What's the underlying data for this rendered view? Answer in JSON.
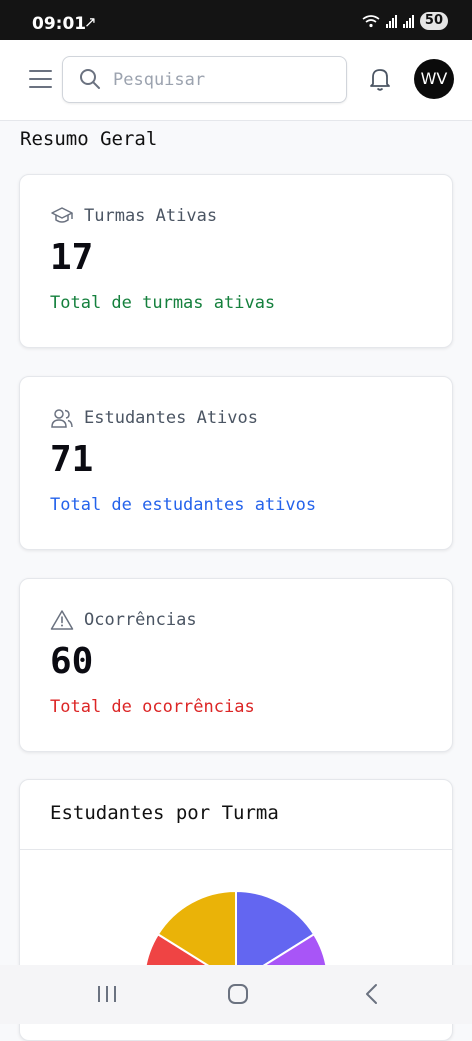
{
  "status_bar": {
    "time": "09:01",
    "battery": "50"
  },
  "header": {
    "search_placeholder": "Pesquisar",
    "avatar_initials": "WV"
  },
  "section_title": "Resumo Geral",
  "cards": [
    {
      "label": "Turmas Ativas",
      "value": "17",
      "description": "Total de turmas ativas",
      "icon": "graduation-cap-icon",
      "desc_color": "#15803d"
    },
    {
      "label": "Estudantes Ativos",
      "value": "71",
      "description": "Total de estudantes ativos",
      "icon": "users-icon",
      "desc_color": "#2563eb"
    },
    {
      "label": "Ocorrências",
      "value": "60",
      "description": "Total de ocorrências",
      "icon": "warning-triangle-icon",
      "desc_color": "#dc2626"
    }
  ],
  "chart": {
    "title": "Estudantes por Turma"
  },
  "chart_data": {
    "type": "pie",
    "title": "Estudantes por Turma",
    "slices_visible_colors": [
      "#6366f1",
      "#a855f7",
      "#ef4444",
      "#eab308"
    ]
  }
}
